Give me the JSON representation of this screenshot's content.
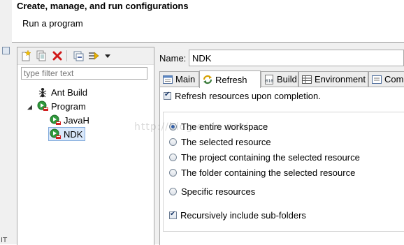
{
  "header": {
    "title": "Create, manage, and run configurations",
    "subtitle": "Run a program"
  },
  "left_pane": {
    "filter_placeholder": "type filter text",
    "tree": [
      {
        "label": "Ant Build",
        "icon": "ant-build-icon",
        "level": 1
      },
      {
        "label": "Program",
        "icon": "program-launch-icon",
        "level": 1,
        "expanded": true
      },
      {
        "label": "JavaH",
        "icon": "program-config-icon",
        "level": 2
      },
      {
        "label": "NDK",
        "icon": "program-config-icon",
        "level": 2,
        "selected": true
      }
    ],
    "toolbar_icons": [
      "new-launch-config-icon",
      "duplicate-icon",
      "delete-icon",
      "collapse-all-icon",
      "filter-icon",
      "view-menu-icon"
    ]
  },
  "name_field": {
    "label": "Name:",
    "value": "NDK"
  },
  "tabs": [
    {
      "label": "Main",
      "icon": "main-tab-icon"
    },
    {
      "label": "Refresh",
      "icon": "refresh-icon",
      "active": true
    },
    {
      "label": "Build",
      "icon": "build-icon"
    },
    {
      "label": "Environment",
      "icon": "environment-icon"
    },
    {
      "label": "Com",
      "icon": "common-icon"
    }
  ],
  "refresh": {
    "refresh_on_completion": {
      "label": "Refresh resources upon completion.",
      "checked": true
    },
    "options": [
      {
        "label": "The entire workspace",
        "selected": true
      },
      {
        "label": "The selected resource",
        "selected": false
      },
      {
        "label": "The project containing the selected resource",
        "selected": false
      },
      {
        "label": "The folder containing the selected resource",
        "selected": false
      },
      {
        "label": "Specific resources",
        "selected": false
      }
    ],
    "recursive": {
      "label": "Recursively include sub-folders",
      "checked": true
    }
  },
  "watermark": "http://blog.csdn.net/"
}
